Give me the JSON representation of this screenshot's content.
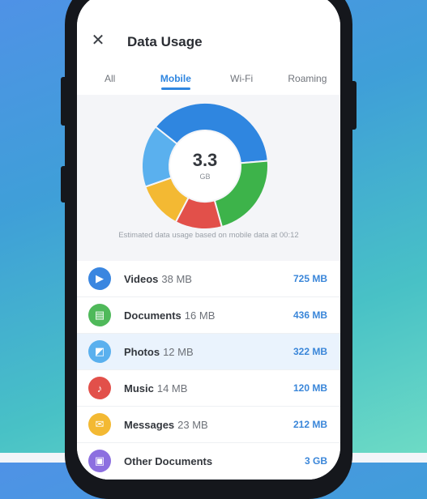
{
  "screen": {
    "title": "Data Usage",
    "tabs": [
      {
        "label": "All",
        "active": false
      },
      {
        "label": "Mobile",
        "active": true
      },
      {
        "label": "Wi-Fi",
        "active": false
      },
      {
        "label": "Roaming",
        "active": false
      }
    ]
  },
  "chart": {
    "center_value": "3.3",
    "center_unit": "GB",
    "caption": "Estimated data usage based on mobile data at 00:12",
    "segments": [
      {
        "label": "Videos",
        "share": 0.38,
        "color": "#2f86e0"
      },
      {
        "label": "Documents",
        "share": 0.22,
        "color": "#3db34a"
      },
      {
        "label": "Photos",
        "share": 0.12,
        "color": "#e2504a"
      },
      {
        "label": "Music",
        "share": 0.12,
        "color": "#f3b933"
      },
      {
        "label": "Messages",
        "share": 0.16,
        "color": "#5ab0ee"
      }
    ]
  },
  "list": [
    {
      "label": "Videos",
      "count": "38 MB",
      "size": "725 MB",
      "color": "#3a86e0",
      "icon": "play-icon",
      "highlight": false
    },
    {
      "label": "Documents",
      "count": "16 MB",
      "size": "436 MB",
      "color": "#4fb95a",
      "icon": "document-icon",
      "highlight": false
    },
    {
      "label": "Photos",
      "count": "12 MB",
      "size": "322 MB",
      "color": "#5ab0ee",
      "icon": "photo-icon",
      "highlight": true
    },
    {
      "label": "Music",
      "count": "14 MB",
      "size": "120 MB",
      "color": "#e2504a",
      "icon": "music-icon",
      "highlight": false
    },
    {
      "label": "Messages",
      "count": "23 MB",
      "size": "212 MB",
      "color": "#f3b933",
      "icon": "message-icon",
      "highlight": false
    },
    {
      "label": "Other Documents",
      "count": "",
      "size": "3 GB",
      "color": "#8c6fe0",
      "icon": "folder-icon",
      "highlight": false
    }
  ]
}
